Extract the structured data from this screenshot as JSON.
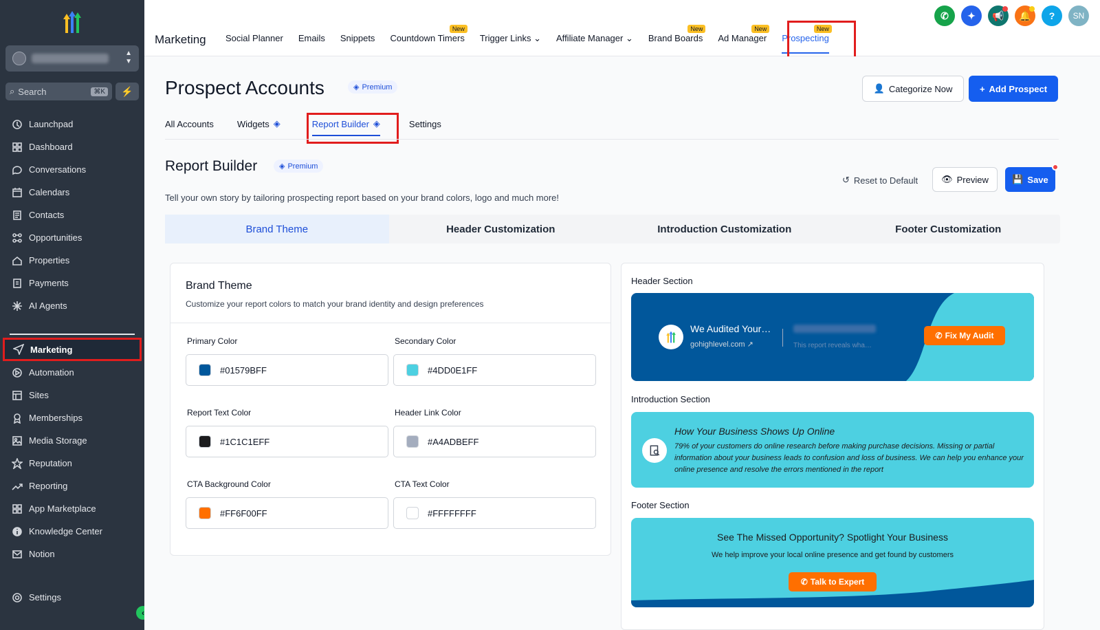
{
  "sidebar": {
    "search_placeholder": "Search",
    "search_shortcut": "⌘K",
    "items": [
      {
        "label": "Launchpad",
        "icon": "rocket-icon"
      },
      {
        "label": "Dashboard",
        "icon": "grid-icon"
      },
      {
        "label": "Conversations",
        "icon": "chat-icon"
      },
      {
        "label": "Calendars",
        "icon": "calendar-icon"
      },
      {
        "label": "Contacts",
        "icon": "contacts-icon"
      },
      {
        "label": "Opportunities",
        "icon": "funnel-icon"
      },
      {
        "label": "Properties",
        "icon": "home-icon"
      },
      {
        "label": "Payments",
        "icon": "receipt-icon"
      },
      {
        "label": "AI Agents",
        "icon": "sparkle-icon"
      }
    ],
    "items2": [
      {
        "label": "Marketing",
        "icon": "send-icon"
      },
      {
        "label": "Automation",
        "icon": "automation-icon"
      },
      {
        "label": "Sites",
        "icon": "sites-icon"
      },
      {
        "label": "Memberships",
        "icon": "award-icon"
      },
      {
        "label": "Media Storage",
        "icon": "image-icon"
      },
      {
        "label": "Reputation",
        "icon": "star-icon"
      },
      {
        "label": "Reporting",
        "icon": "trend-icon"
      },
      {
        "label": "App Marketplace",
        "icon": "apps-icon"
      },
      {
        "label": "Knowledge Center",
        "icon": "info-icon"
      },
      {
        "label": "Notion",
        "icon": "mail-icon"
      }
    ],
    "settings_label": "Settings"
  },
  "topbar": {
    "section_title": "Marketing",
    "nav": [
      {
        "label": "Social Planner",
        "badge": ""
      },
      {
        "label": "Emails",
        "badge": ""
      },
      {
        "label": "Snippets",
        "badge": ""
      },
      {
        "label": "Countdown Timers",
        "badge": "New"
      },
      {
        "label": "Trigger Links",
        "badge": "",
        "dropdown": true
      },
      {
        "label": "Affiliate Manager",
        "badge": "",
        "dropdown": true
      },
      {
        "label": "Brand Boards",
        "badge": "New"
      },
      {
        "label": "Ad Manager",
        "badge": "New"
      },
      {
        "label": "Prospecting",
        "badge": "New",
        "active": true
      }
    ],
    "user_initials": "SN",
    "help_label": "?"
  },
  "page": {
    "title": "Prospect Accounts",
    "premium_label": "Premium",
    "categorize_label": "Categorize Now",
    "add_prospect_label": "Add Prospect",
    "subtabs": [
      "All Accounts",
      "Widgets",
      "Report Builder",
      "Settings"
    ]
  },
  "report_builder": {
    "title": "Report Builder",
    "premium_label": "Premium",
    "description": "Tell your own story by tailoring prospecting report based on your brand colors, logo and much more!",
    "reset_label": "Reset to Default",
    "preview_label": "Preview",
    "save_label": "Save",
    "tabs": [
      "Brand Theme",
      "Header Customization",
      "Introduction Customization",
      "Footer Customization"
    ]
  },
  "brand_theme": {
    "title": "Brand Theme",
    "description": "Customize your report colors to match your brand identity and design preferences",
    "fields": [
      {
        "label": "Primary Color",
        "value": "#01579BFF",
        "color": "#01579b"
      },
      {
        "label": "Secondary Color",
        "value": "#4DD0E1FF",
        "color": "#4dd0e1"
      },
      {
        "label": "Report Text Color",
        "value": "#1C1C1EFF",
        "color": "#1c1c1e"
      },
      {
        "label": "Header Link Color",
        "value": "#A4ADBEFF",
        "color": "#a4adbe"
      },
      {
        "label": "CTA Background Color",
        "value": "#FF6F00FF",
        "color": "#ff6f00"
      },
      {
        "label": "CTA Text Color",
        "value": "#FFFFFFFF",
        "color": "#ffffff"
      }
    ]
  },
  "preview": {
    "header_label": "Header Section",
    "header_title": "We Audited Your…",
    "header_link": "gohighlevel.com",
    "header_sub": "This report reveals wha…",
    "header_cta": "Fix My Audit",
    "intro_label": "Introduction Section",
    "intro_title": "How Your Business Shows Up Online",
    "intro_text": "79% of your customers do online research before making purchase decisions. Missing or partial information about your business leads to confusion and loss of business. We can help you enhance your online presence and resolve the errors mentioned in the report",
    "footer_label": "Footer Section",
    "footer_title": "See The Missed Opportunity? Spotlight Your Business",
    "footer_text": "We help improve your local online presence and get found by customers",
    "footer_cta": "Talk to Expert"
  }
}
